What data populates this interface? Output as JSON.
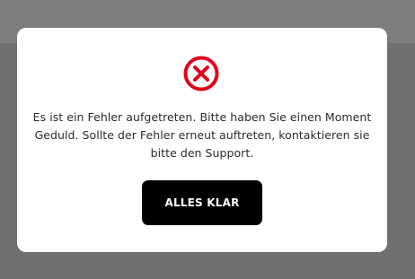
{
  "dialog": {
    "icon": "error-circle-x-icon",
    "message_lines": [
      "Es ist ein Fehler aufgetreten. Bitte haben Sie einen Moment",
      "Geduld. Sollte der Fehler erneut auftreten, kontaktieren sie",
      "bitte den Support."
    ],
    "confirm_label": "ALLES KLAR"
  },
  "colors": {
    "overlay": "#6f6f6f",
    "top_band": "#7d7d7d",
    "modal_background": "#ffffff",
    "error_red": "#e2001a",
    "button_background": "#000000",
    "button_text": "#ffffff",
    "text": "#2b2b2b"
  }
}
